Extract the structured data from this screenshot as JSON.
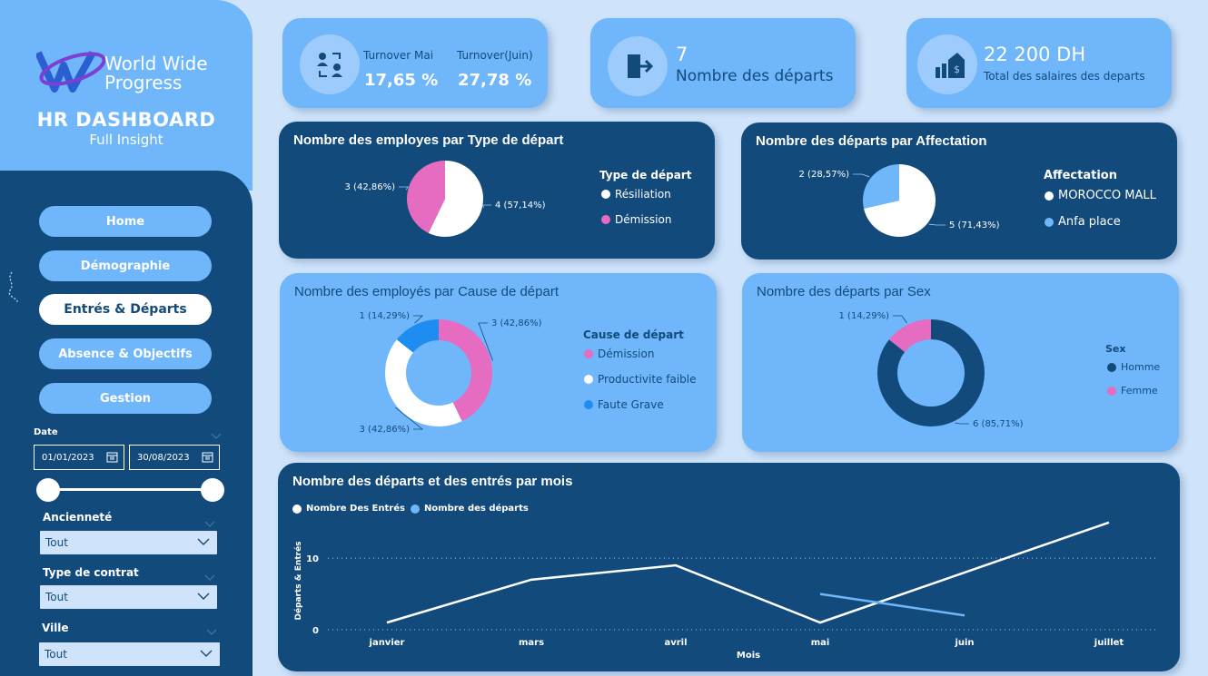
{
  "brand": {
    "line1": "World Wide",
    "line2": "Progress"
  },
  "header": {
    "title": "HR DASHBOARD",
    "subtitle": "Full Insight"
  },
  "nav": [
    {
      "label": "Home",
      "active": false
    },
    {
      "label": "Démographie",
      "active": false
    },
    {
      "label": "Entrés & Départs",
      "active": true
    },
    {
      "label": "Absence & Objectifs",
      "active": false
    },
    {
      "label": "Gestion",
      "active": false
    }
  ],
  "filters": {
    "date_label": "Date",
    "date_start": "01/01/2023",
    "date_end": "30/08/2023",
    "anciennete_label": "Ancienneté",
    "anciennete_value": "Tout",
    "contrat_label": "Type de contrat",
    "contrat_value": "Tout",
    "ville_label": "Ville",
    "ville_value": "Tout"
  },
  "kpis": {
    "turnover_mai_label": "Turnover Mai",
    "turnover_mai_value": "17,65 %",
    "turnover_juin_label": "Turnover(Juin)",
    "turnover_juin_value": "27,78 %",
    "departs_value": "7",
    "departs_label": "Nombre des départs",
    "salaires_value": "22 200 DH",
    "salaires_label": "Total des salaires des departs"
  },
  "colors": {
    "dark": "#124a7c",
    "light": "#6fb6fb",
    "pink": "#e56cc0",
    "white": "#ffffff",
    "blue": "#1e8cf0",
    "sky": "#6fb6fb"
  },
  "chart_data": [
    {
      "type": "pie",
      "title": "Nombre des employes par Type de départ",
      "legend_title": "Type de départ",
      "slices": [
        {
          "name": "Résiliation",
          "value": 4,
          "label": "4 (57,14%)",
          "color": "#ffffff"
        },
        {
          "name": "Démission",
          "value": 3,
          "label": "3 (42,86%)",
          "color": "#e56cc0"
        }
      ]
    },
    {
      "type": "pie",
      "title": "Nombre des départs par Affectation",
      "legend_title": "Affectation",
      "slices": [
        {
          "name": "MOROCCO MALL",
          "value": 5,
          "label": "5 (71,43%)",
          "color": "#ffffff"
        },
        {
          "name": "Anfa place",
          "value": 2,
          "label": "2 (28,57%)",
          "color": "#6fb6fb"
        }
      ]
    },
    {
      "type": "pie",
      "title": "Nombre des employés par Cause de départ",
      "legend_title": "Cause de départ",
      "slices": [
        {
          "name": "Démission",
          "value": 3,
          "label": "3 (42,86%)",
          "color": "#e56cc0"
        },
        {
          "name": "Productivite faible",
          "value": 3,
          "label": "3 (42,86%)",
          "color": "#ffffff"
        },
        {
          "name": "Faute Grave",
          "value": 1,
          "label": "1 (14,29%)",
          "color": "#1e8cf0"
        }
      ]
    },
    {
      "type": "pie",
      "title": "Nombre des départs par Sex",
      "legend_title": "Sex",
      "slices": [
        {
          "name": "Homme",
          "value": 6,
          "label": "6 (85,71%)",
          "color": "#124a7c"
        },
        {
          "name": "Femme",
          "value": 1,
          "label": "1 (14,29%)",
          "color": "#e56cc0"
        }
      ]
    },
    {
      "type": "line",
      "title": "Nombre des départs et des entrés par mois",
      "xlabel": "Mois",
      "ylabel": "Départs & Entrés",
      "categories": [
        "janvier",
        "mars",
        "avril",
        "mai",
        "juin",
        "juillet"
      ],
      "yticks": [
        0,
        10
      ],
      "ylim": [
        0,
        17
      ],
      "grid": true,
      "series": [
        {
          "name": "Nombre Des Entrés",
          "color": "#ffffff",
          "values": [
            1,
            7,
            9,
            1,
            null,
            15
          ]
        },
        {
          "name": "Nombre des départs",
          "color": "#6fb6fb",
          "values": [
            null,
            null,
            null,
            5,
            2,
            null
          ]
        }
      ]
    }
  ]
}
